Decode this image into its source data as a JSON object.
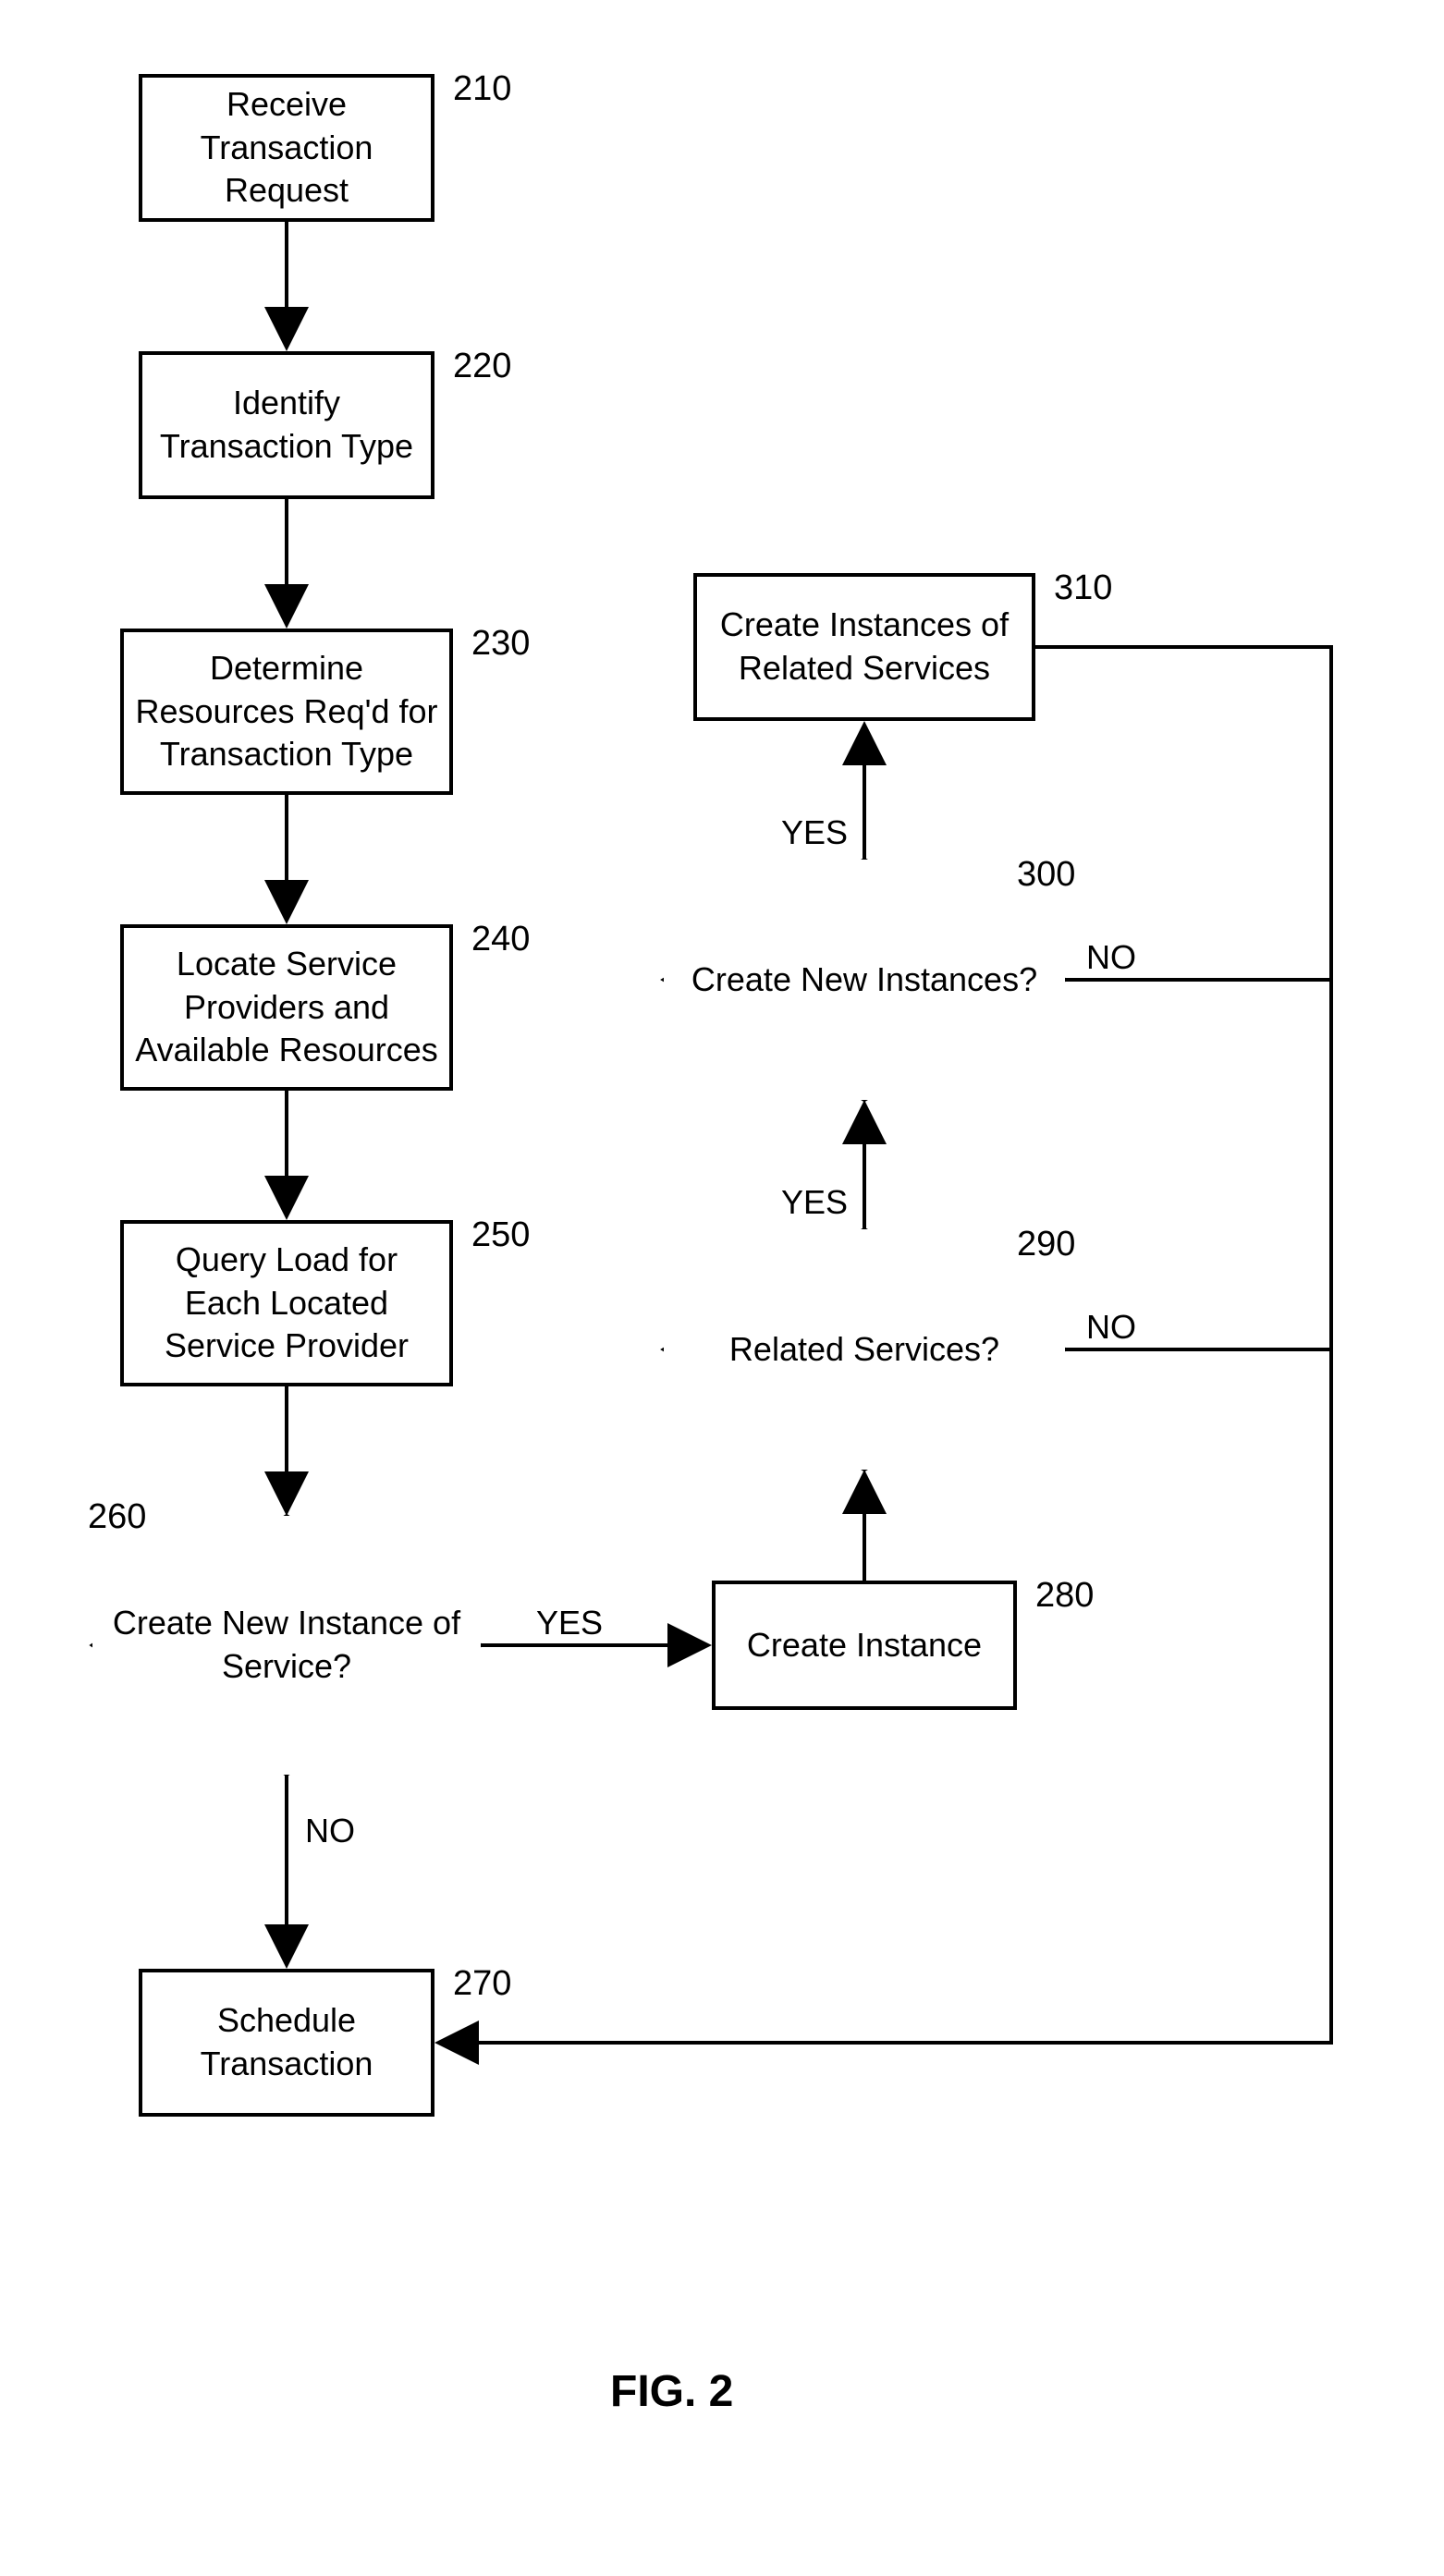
{
  "nodes": {
    "n210": {
      "text": "Receive Transaction Request",
      "label": "210"
    },
    "n220": {
      "text": "Identify Transaction Type",
      "label": "220"
    },
    "n230": {
      "text": "Determine Resources Req'd for Transaction Type",
      "label": "230"
    },
    "n240": {
      "text": "Locate Service Providers and Available Resources",
      "label": "240"
    },
    "n250": {
      "text": "Query Load for Each Located Service Provider",
      "label": "250"
    },
    "n260": {
      "text": "Create New Instance of Service?",
      "label": "260"
    },
    "n270": {
      "text": "Schedule Transaction",
      "label": "270"
    },
    "n280": {
      "text": "Create Instance",
      "label": "280"
    },
    "n290": {
      "text": "Related Services?",
      "label": "290"
    },
    "n300": {
      "text": "Create New Instances?",
      "label": "300"
    },
    "n310": {
      "text": "Create Instances of Related Services",
      "label": "310"
    }
  },
  "edges": {
    "yes260": "YES",
    "no260": "NO",
    "yes290": "YES",
    "no290": "NO",
    "yes300": "YES",
    "no300": "NO"
  },
  "figure": "FIG. 2"
}
